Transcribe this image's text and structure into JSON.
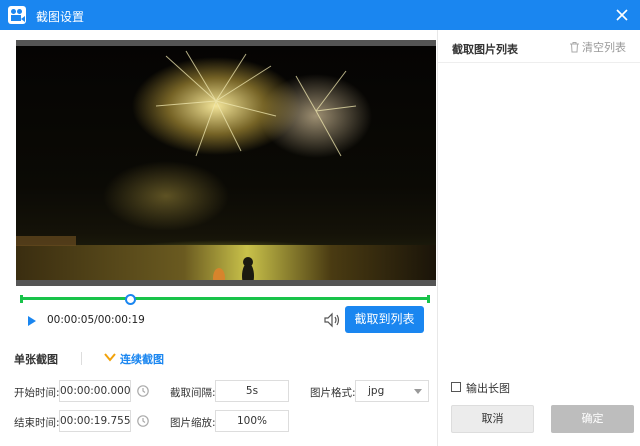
{
  "window": {
    "title": "截图设置"
  },
  "player": {
    "timecode": "00:00:05/00:00:19",
    "progress": 0.263,
    "capture_label": "截取到列表"
  },
  "modes": {
    "single": "单张截图",
    "continuous": "连续截图"
  },
  "settings": {
    "start_label": "开始时间:",
    "start_value": "00:00:00.000",
    "end_label": "结束时间:",
    "end_value": "00:00:19.755",
    "interval_label": "截取间隔:",
    "interval_value": "5s",
    "scale_label": "图片缩放:",
    "scale_value": "100%",
    "format_label": "图片格式:",
    "format_value": "jpg"
  },
  "list": {
    "title": "截取图片列表",
    "clear_label": "清空列表",
    "long_image_label": "输出长图",
    "long_image_checked": false,
    "cancel_label": "取消",
    "ok_label": "确定"
  },
  "colors": {
    "accent": "#1a86f0",
    "timeline": "#18c34a",
    "disabled": "#bdbdbd"
  }
}
